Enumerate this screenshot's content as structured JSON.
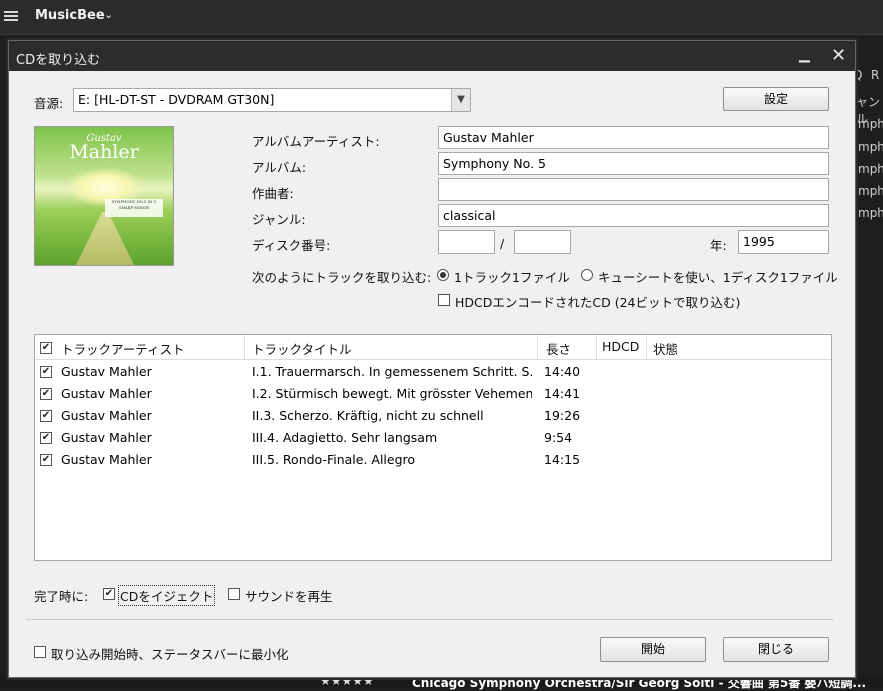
{
  "app": {
    "title": "MusicBee"
  },
  "background": {
    "right_fragments": [
      "ャンル",
      "mph",
      "mph",
      "mph",
      "mph",
      "mph"
    ],
    "header_fragments": [
      "Q",
      "R"
    ],
    "bottom_text": "Chicago Symphony Orchestra/Sir Georg Solti - 交響曲 第5番 嬰ハ短調...",
    "rating": "★★★★★"
  },
  "dialog": {
    "title": "CDを取り込む",
    "source_label": "音源:",
    "source_value": "E: [HL-DT-ST - DVDRAM GT30N]",
    "settings_button": "設定",
    "album_art": {
      "line1": "Gustav",
      "line2": "Mahler",
      "subtitle": "SYMPHONY NO.5 IN C SHARP MINOR"
    },
    "fields": {
      "album_artist_label": "アルバムアーティスト:",
      "album_artist": "Gustav Mahler",
      "album_label": "アルバム:",
      "album": "Symphony No. 5",
      "composer_label": "作曲者:",
      "composer": "",
      "genre_label": "ジャンル:",
      "genre": "classical",
      "disc_label": "ディスク番号:",
      "disc_number": "",
      "disc_separator": "/",
      "disc_count": "",
      "year_label": "年:",
      "year": "1995"
    },
    "rip_mode": {
      "label": "次のようにトラックを取り込む:",
      "option1": "1トラック1ファイル",
      "option2": "キューシートを使い、1ディスク1ファイル",
      "selected": "1トラック1ファイル",
      "hdcd_label": "HDCDエンコードされたCD (24ビットで取り込む)",
      "hdcd_checked": false
    },
    "table": {
      "columns": [
        "トラックアーティスト",
        "トラックタイトル",
        "長さ",
        "HDCD",
        "状態"
      ],
      "rows": [
        {
          "checked": true,
          "artist": "Gustav Mahler",
          "title": "I.1. Trauermarsch. In gemessenem Schritt. S...",
          "length": "14:40",
          "hdcd": "",
          "status": ""
        },
        {
          "checked": true,
          "artist": "Gustav Mahler",
          "title": "I.2. Stürmisch bewegt. Mit grösster Vehemenz",
          "length": "14:41",
          "hdcd": "",
          "status": ""
        },
        {
          "checked": true,
          "artist": "Gustav Mahler",
          "title": "II.3. Scherzo. Kräftig, nicht zu schnell",
          "length": "19:26",
          "hdcd": "",
          "status": ""
        },
        {
          "checked": true,
          "artist": "Gustav Mahler",
          "title": "III.4. Adagietto. Sehr langsam",
          "length": "9:54",
          "hdcd": "",
          "status": ""
        },
        {
          "checked": true,
          "artist": "Gustav Mahler",
          "title": "III.5. Rondo-Finale. Allegro",
          "length": "14:15",
          "hdcd": "",
          "status": ""
        }
      ]
    },
    "on_complete": {
      "label": "完了時に:",
      "eject_label": "CDをイジェクト",
      "eject_checked": true,
      "sound_label": "サウンドを再生",
      "sound_checked": false
    },
    "minimize_label": "取り込み開始時、ステータスバーに最小化",
    "minimize_checked": false,
    "start_button": "開始",
    "close_button": "閉じる"
  }
}
